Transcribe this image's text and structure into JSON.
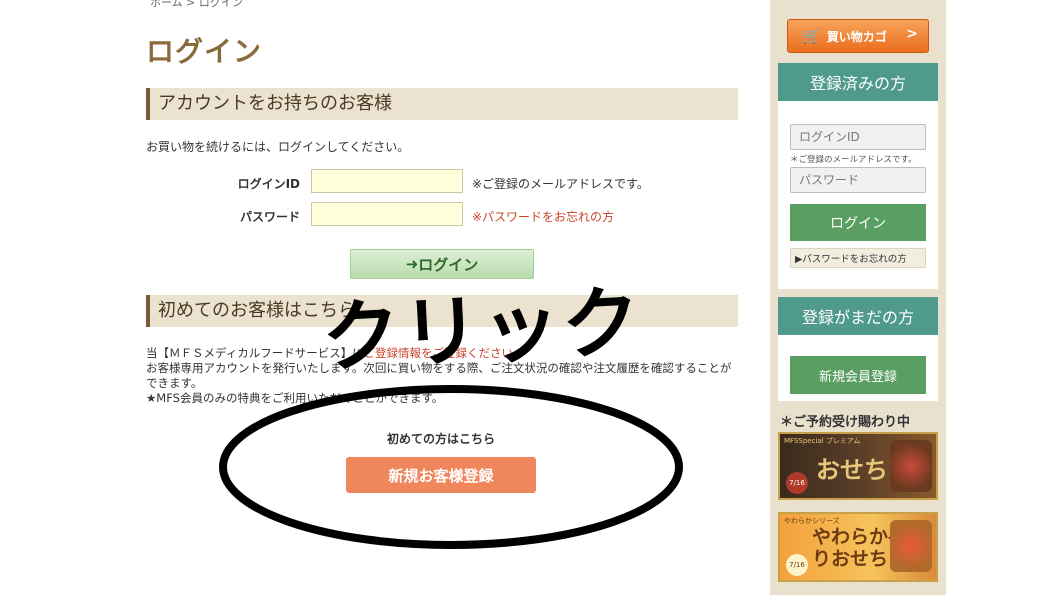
{
  "breadcrumb": "ホーム > ログイン",
  "page_title": "ログイン",
  "section_account": {
    "heading": "アカウントをお持ちのお客様",
    "intro": "お買い物を続けるには、ログインしてください。",
    "login_id_label": "ログインID",
    "login_id_note": "※ご登録のメールアドレスです。",
    "password_label": "パスワード",
    "password_forgot": "※パスワードをお忘れの方",
    "login_button": "ログイン",
    "login_icon": "sign-in-icon"
  },
  "section_first": {
    "heading": "初めてのお客様はこちら",
    "text_line1_a": "当【ＭＦＳメディカルフードサービス】に",
    "text_line1_b": "ご登録情報をご登録ください",
    "text_line2": "お客様専用アカウントを発行いたします。次回に買い物をする際、ご注文状況の確認や注文履歴を確認することができます。",
    "text_line3": "★MFS会員のみの特典をご利用いただくことができます。",
    "first_label": "初めての方はこちら",
    "register_button": "新規お客様登録"
  },
  "annotation": {
    "text": "クリック",
    "color": "#000000"
  },
  "sidebar": {
    "cart_button": "買い物カゴ",
    "cart_arrow": ">",
    "cart_icon": "cart-icon",
    "registered_heading": "登録済みの方",
    "login_id_placeholder": "ログインID",
    "login_id_note": "＊ご登録のメールアドレスです。",
    "password_placeholder": "パスワード",
    "login_button": "ログイン",
    "forgot_password": "▶パスワードをお忘れの方",
    "unregistered_heading": "登録がまだの方",
    "register_button": "新規会員登録",
    "reserve_title": "＊ご予約受け賜わり中",
    "banner1": {
      "sub": "MFSSpecial プレミアム",
      "main": "おせち",
      "date": "7/16"
    },
    "banner2": {
      "sub": "やわらかシリーズ",
      "main": "やわらか手作りおせち",
      "date": "7/16"
    }
  },
  "colors": {
    "accent_brown": "#8a6a3d",
    "sidebar_teal": "#4f9a8c",
    "button_green": "#5a9e62",
    "register_orange": "#f0865c",
    "cart_orange": "#ea6e1e",
    "link_red": "#c9442a"
  }
}
